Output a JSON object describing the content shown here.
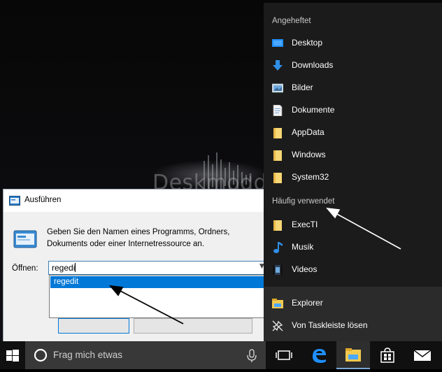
{
  "watermark": "Deskmodder.de",
  "run_dialog": {
    "title": "Ausführen",
    "description": "Geben Sie den Namen eines Programms, Ordners, Dokuments oder einer Internetressource an.",
    "open_label": "Öffnen:",
    "input_value": "regedi",
    "suggestion": "regedit"
  },
  "jumplist": {
    "pinned_header": "Angeheftet",
    "pinned": [
      {
        "label": "Desktop",
        "icon": "desktop-icon"
      },
      {
        "label": "Downloads",
        "icon": "download-arrow-icon"
      },
      {
        "label": "Bilder",
        "icon": "pictures-icon"
      },
      {
        "label": "Dokumente",
        "icon": "document-icon"
      },
      {
        "label": "AppData",
        "icon": "folder-icon"
      },
      {
        "label": "Windows",
        "icon": "folder-icon"
      },
      {
        "label": "System32",
        "icon": "folder-icon"
      }
    ],
    "frequent_header": "Häufig verwendet",
    "frequent": [
      {
        "label": "ExecTI",
        "icon": "folder-icon"
      },
      {
        "label": "Musik",
        "icon": "music-note-icon"
      },
      {
        "label": "Videos",
        "icon": "video-icon"
      }
    ],
    "actions": [
      {
        "label": "Explorer",
        "icon": "file-explorer-icon"
      },
      {
        "label": "Von Taskleiste lösen",
        "icon": "unpin-icon"
      }
    ]
  },
  "taskbar": {
    "search_placeholder": "Frag mich etwas",
    "icons": [
      "windows-start-icon",
      "cortana-icon",
      "microphone-icon",
      "task-view-icon",
      "edge-icon",
      "file-explorer-icon",
      "store-icon",
      "mail-icon"
    ],
    "accent_color": "#0078d7"
  }
}
